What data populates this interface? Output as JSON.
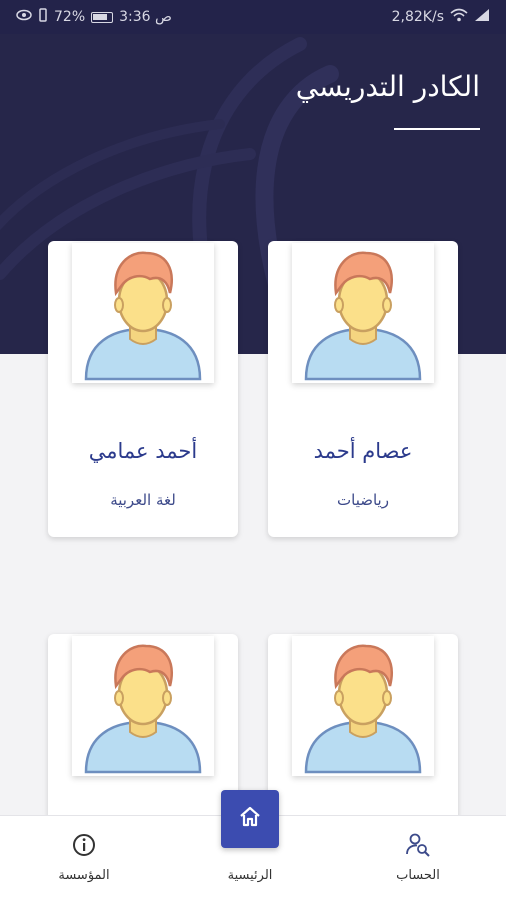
{
  "status_bar": {
    "time": "3:36 ص",
    "battery": "72%",
    "speed": "2,82K/s"
  },
  "header": {
    "title": "الكادر التدريسي"
  },
  "teachers": [
    {
      "name": "عصام أحمد",
      "subject": "رياضيات"
    },
    {
      "name": "أحمد عمامي",
      "subject": "لغة العربية"
    },
    {
      "name": "",
      "subject": ""
    },
    {
      "name": "",
      "subject": ""
    }
  ],
  "bottom_nav": {
    "account": {
      "label": "الحساب",
      "icon": "user-search-icon"
    },
    "home": {
      "label": "الرئيسية",
      "icon": "home-icon"
    },
    "institution": {
      "label": "المؤسسة",
      "icon": "info-icon"
    }
  },
  "colors": {
    "header_bg": "#26264a",
    "accent": "#3c4cb0",
    "name_text": "#2b3a8c"
  }
}
